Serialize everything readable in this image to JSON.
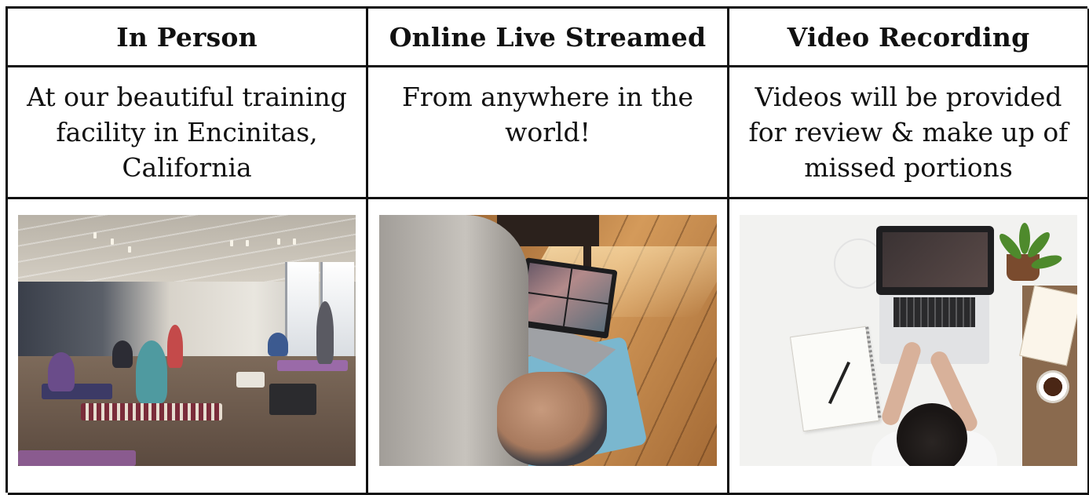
{
  "columns": [
    {
      "header": "In Person",
      "description": "At our beautiful training facility in Encinitas, California",
      "image": "yoga-studio-training-photo"
    },
    {
      "header": "Online Live Streamed",
      "description": "From anywhere in the world!",
      "image": "online-video-call-laptop-photo"
    },
    {
      "header": "Video Recording",
      "description": "Videos will be provided for review & make up of missed portions",
      "image": "laptop-desk-workspace-photo"
    }
  ]
}
